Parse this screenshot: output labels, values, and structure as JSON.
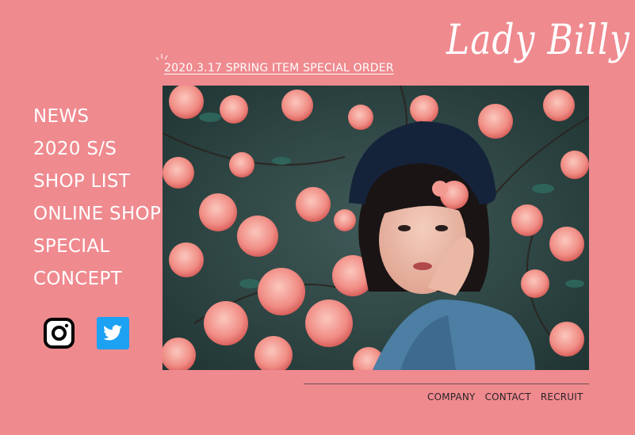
{
  "header": {
    "logo_text": "Lady Billy"
  },
  "news": {
    "label": "2020.3.17 SPRING ITEM SPECIAL ORDER"
  },
  "nav": {
    "items": [
      {
        "label": "NEWS"
      },
      {
        "label": "2020 S/S"
      },
      {
        "label": "SHOP LIST"
      },
      {
        "label": "ONLINE SHOP"
      },
      {
        "label": "SPECIAL"
      },
      {
        "label": "CONCEPT"
      }
    ]
  },
  "social": [
    {
      "icon": "instagram-icon"
    },
    {
      "icon": "twitter-icon",
      "color": "#1da1f2"
    }
  ],
  "footer": {
    "links": [
      {
        "label": "COMPANY"
      },
      {
        "label": "CONTACT"
      },
      {
        "label": "RECRUIT"
      }
    ]
  },
  "colors": {
    "background": "#ef8a8f",
    "text": "#ffffff",
    "footer_text": "#2a2325"
  }
}
